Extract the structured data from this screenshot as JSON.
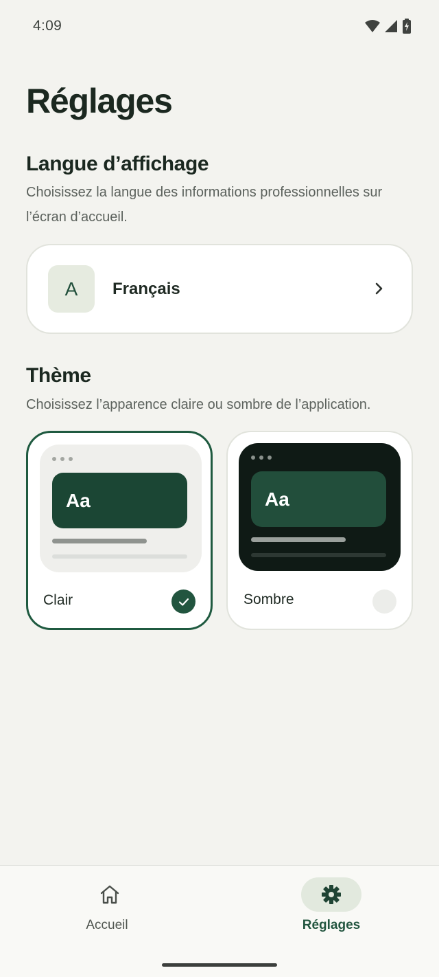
{
  "status_bar": {
    "time": "4:09",
    "icons": [
      "wifi-icon",
      "cell-signal-icon",
      "battery-charging-icon"
    ]
  },
  "page": {
    "title": "Réglages"
  },
  "language_section": {
    "title": "Langue d’affichage",
    "description": "Choisissez la langue des informations professionnelles sur l’écran d’accueil.",
    "current": {
      "avatar_letter": "A",
      "label": "Français"
    }
  },
  "theme_section": {
    "title": "Thème",
    "description": "Choisissez l’apparence claire ou sombre de l’application.",
    "options": [
      {
        "label": "Clair",
        "preview_text": "Aa",
        "selected": true
      },
      {
        "label": "Sombre",
        "preview_text": "Aa",
        "selected": false
      }
    ]
  },
  "bottom_nav": {
    "items": [
      {
        "label": "Accueil",
        "icon": "home-icon",
        "active": false
      },
      {
        "label": "Réglages",
        "icon": "gear-icon",
        "active": true
      }
    ]
  },
  "colors": {
    "background": "#f3f3ef",
    "accent": "#22553f",
    "text": "#1b2820"
  }
}
